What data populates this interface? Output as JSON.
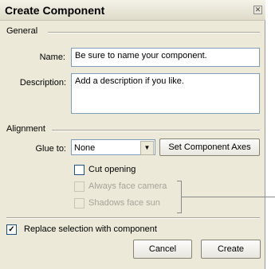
{
  "dialog": {
    "title": "Create Component",
    "close_glyph": "✕"
  },
  "general": {
    "group_label": "General",
    "name_label": "Name:",
    "name_value": "Be sure to name your component.",
    "description_label": "Description:",
    "description_value": "Add a description if you like."
  },
  "alignment": {
    "group_label": "Alignment",
    "glue_label": "Glue to:",
    "glue_value": "None",
    "set_axes_label": "Set Component Axes",
    "cut_opening_label": "Cut opening",
    "cut_opening_checked": false,
    "face_camera_label": "Always face camera",
    "face_camera_checked": false,
    "shadows_sun_label": "Shadows face sun",
    "shadows_sun_checked": false
  },
  "replace": {
    "label": "Replace selection with component",
    "checked": true,
    "check_glyph": "✓"
  },
  "buttons": {
    "cancel": "Cancel",
    "create": "Create"
  },
  "icons": {
    "close": "close-icon",
    "dropdown": "chevron-down-icon",
    "check": "checkmark-icon"
  }
}
